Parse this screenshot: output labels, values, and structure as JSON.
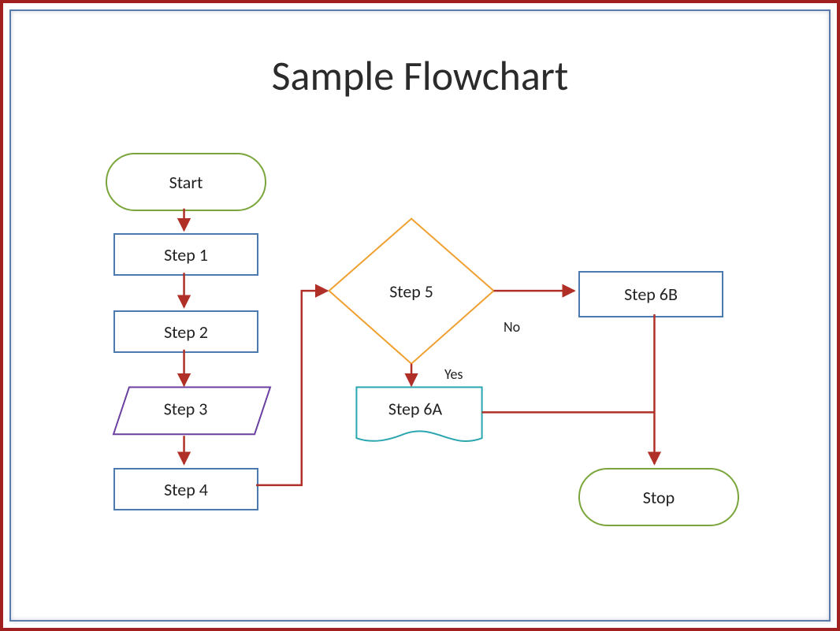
{
  "title": "Sample Flowchart",
  "nodes": {
    "start": {
      "label": "Start"
    },
    "step1": {
      "label": "Step 1"
    },
    "step2": {
      "label": "Step 2"
    },
    "step3": {
      "label": "Step 3"
    },
    "step4": {
      "label": "Step 4"
    },
    "step5": {
      "label": "Step 5"
    },
    "step6a": {
      "label": "Step 6A"
    },
    "step6b": {
      "label": "Step 6B"
    },
    "stop": {
      "label": "Stop"
    }
  },
  "branches": {
    "no": "No",
    "yes": "Yes"
  },
  "colors": {
    "terminator": "#7aa53a",
    "process": "#4a7ab0",
    "decision": "#f0a030",
    "io": "#6a3fa0",
    "document": "#2aa6b0",
    "connector": "#b03028"
  }
}
